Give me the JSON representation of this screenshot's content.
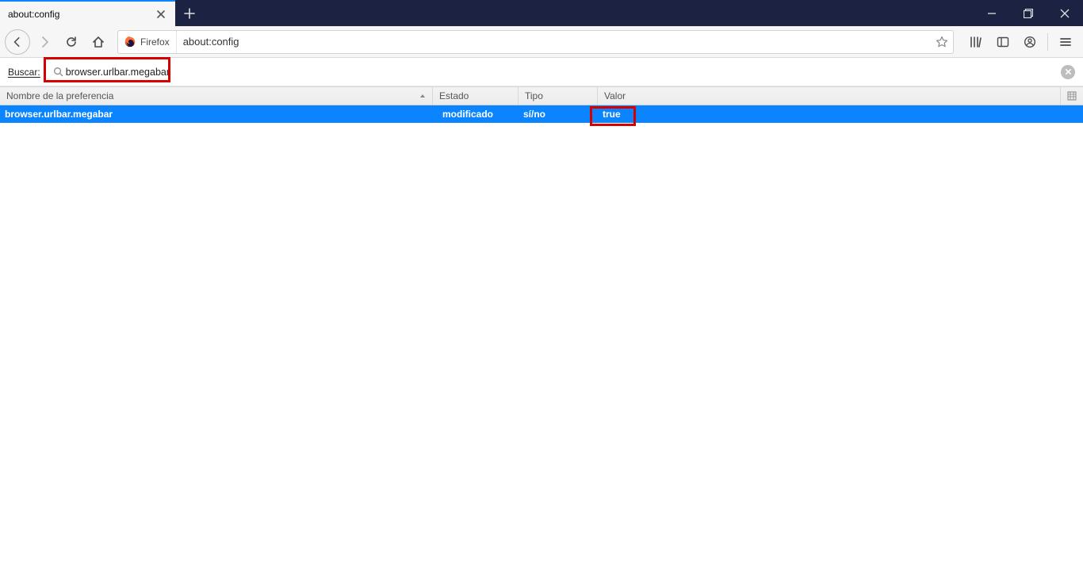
{
  "window": {
    "tab_title": "about:config",
    "identity_label": "Firefox",
    "url": "about:config"
  },
  "search": {
    "label": "Buscar:",
    "value": "browser.urlbar.megabar"
  },
  "columns": {
    "name": "Nombre de la preferencia",
    "status": "Estado",
    "type": "Tipo",
    "value": "Valor"
  },
  "rows": [
    {
      "name": "browser.urlbar.megabar",
      "status": "modificado",
      "type": "sí/no",
      "value": "true"
    }
  ]
}
